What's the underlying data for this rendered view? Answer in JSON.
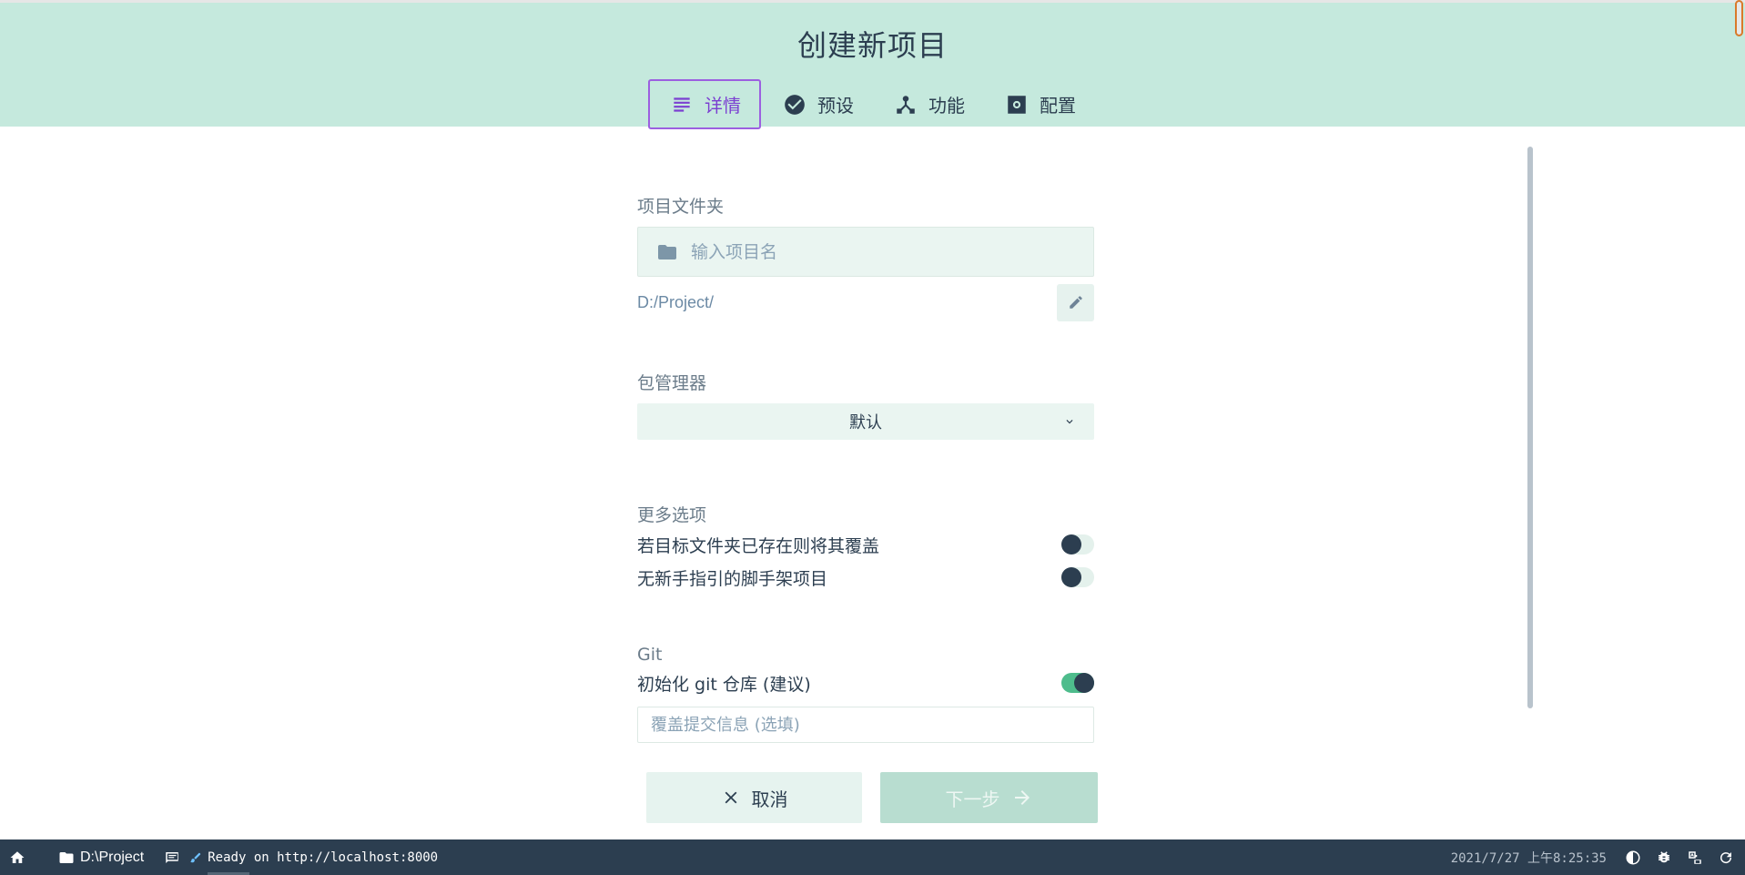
{
  "header": {
    "title": "创建新项目",
    "tabs": [
      {
        "label": "详情",
        "icon": "subject-icon",
        "active": true
      },
      {
        "label": "预设",
        "icon": "check-circle-icon",
        "active": false
      },
      {
        "label": "功能",
        "icon": "device-hub-icon",
        "active": false
      },
      {
        "label": "配置",
        "icon": "settings-icon",
        "active": false
      }
    ]
  },
  "form": {
    "folder_label": "项目文件夹",
    "folder_placeholder": "输入项目名",
    "path": "D:/Project/",
    "package_manager_label": "包管理器",
    "package_manager_value": "默认",
    "more_options_label": "更多选项",
    "options": [
      {
        "label": "若目标文件夹已存在则将其覆盖",
        "on": false
      },
      {
        "label": "无新手指引的脚手架项目",
        "on": false
      }
    ],
    "git_label": "Git",
    "git_init_label": "初始化 git 仓库 (建议)",
    "git_init_on": true,
    "commit_placeholder": "覆盖提交信息 (选填)"
  },
  "actions": {
    "cancel_label": "取消",
    "next_label": "下一步"
  },
  "statusbar": {
    "folder": "D:\\Project",
    "log": "Ready on http://localhost:8000",
    "time": "2021/7/27 上午8:25:35"
  },
  "colors": {
    "header_bg": "#c5e9dd",
    "accent": "#7b3fd1",
    "statusbar_bg": "#2c3e50",
    "toggle_on": "#4ebc8c"
  }
}
